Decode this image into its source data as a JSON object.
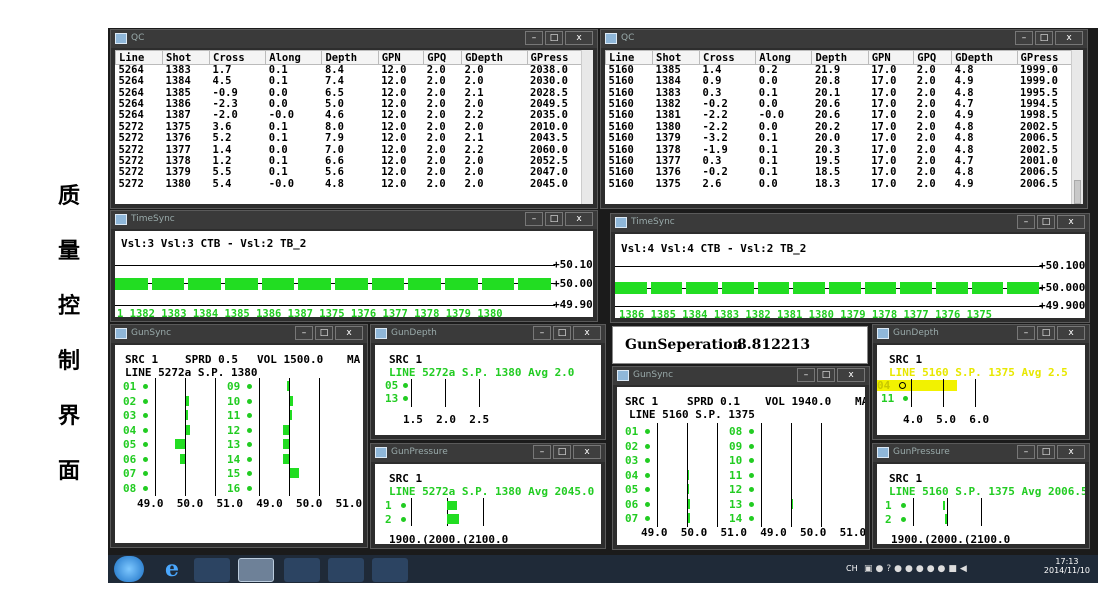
{
  "sidebar": {
    "chars": [
      "质",
      "量",
      "控",
      "制",
      "界",
      "面"
    ]
  },
  "qc_left": {
    "title": "QC",
    "columns": [
      "Line",
      "Shot",
      "Cross",
      "Along",
      "Depth",
      "GPN",
      "GPQ",
      "GDepth",
      "GPress"
    ],
    "rows": [
      [
        "5264",
        "1383",
        "1.7",
        "0.1",
        "8.4",
        "12.0",
        "2.0",
        "2.0",
        "2038.0"
      ],
      [
        "5264",
        "1384",
        "4.5",
        "0.1",
        "7.4",
        "12.0",
        "2.0",
        "2.0",
        "2030.0"
      ],
      [
        "5264",
        "1385",
        "-0.9",
        "0.0",
        "6.5",
        "12.0",
        "2.0",
        "2.1",
        "2028.5"
      ],
      [
        "5264",
        "1386",
        "-2.3",
        "0.0",
        "5.0",
        "12.0",
        "2.0",
        "2.0",
        "2049.5"
      ],
      [
        "5264",
        "1387",
        "-2.0",
        "-0.0",
        "4.6",
        "12.0",
        "2.0",
        "2.2",
        "2035.0"
      ],
      [
        "5272",
        "1375",
        "3.6",
        "0.1",
        "8.0",
        "12.0",
        "2.0",
        "2.0",
        "2010.0"
      ],
      [
        "5272",
        "1376",
        "5.2",
        "0.1",
        "7.9",
        "12.0",
        "2.0",
        "2.1",
        "2043.5"
      ],
      [
        "5272",
        "1377",
        "1.4",
        "0.0",
        "7.0",
        "12.0",
        "2.0",
        "2.2",
        "2060.0"
      ],
      [
        "5272",
        "1378",
        "1.2",
        "0.1",
        "6.6",
        "12.0",
        "2.0",
        "2.0",
        "2052.5"
      ],
      [
        "5272",
        "1379",
        "5.5",
        "0.1",
        "5.6",
        "12.0",
        "2.0",
        "2.0",
        "2047.0"
      ],
      [
        "5272",
        "1380",
        "5.4",
        "-0.0",
        "4.8",
        "12.0",
        "2.0",
        "2.0",
        "2045.0"
      ]
    ]
  },
  "qc_right": {
    "title": "QC",
    "columns": [
      "Line",
      "Shot",
      "Cross",
      "Along",
      "Depth",
      "GPN",
      "GPQ",
      "GDepth",
      "GPress"
    ],
    "rows": [
      [
        "5160",
        "1385",
        "1.4",
        "0.2",
        "21.9",
        "17.0",
        "2.0",
        "4.8",
        "1999.0"
      ],
      [
        "5160",
        "1384",
        "0.9",
        "0.0",
        "20.8",
        "17.0",
        "2.0",
        "4.9",
        "1999.0"
      ],
      [
        "5160",
        "1383",
        "0.3",
        "0.1",
        "20.1",
        "17.0",
        "2.0",
        "4.8",
        "1995.5"
      ],
      [
        "5160",
        "1382",
        "-0.2",
        "0.0",
        "20.6",
        "17.0",
        "2.0",
        "4.7",
        "1994.5"
      ],
      [
        "5160",
        "1381",
        "-2.2",
        "-0.0",
        "20.6",
        "17.0",
        "2.0",
        "4.9",
        "1998.5"
      ],
      [
        "5160",
        "1380",
        "-2.2",
        "0.0",
        "20.2",
        "17.0",
        "2.0",
        "4.8",
        "2002.5"
      ],
      [
        "5160",
        "1379",
        "-3.2",
        "0.1",
        "20.0",
        "17.0",
        "2.0",
        "4.8",
        "2006.5"
      ],
      [
        "5160",
        "1378",
        "-1.9",
        "0.1",
        "20.3",
        "17.0",
        "2.0",
        "4.8",
        "2002.5"
      ],
      [
        "5160",
        "1377",
        "0.3",
        "0.1",
        "19.5",
        "17.0",
        "2.0",
        "4.7",
        "2001.0"
      ],
      [
        "5160",
        "1376",
        "-0.2",
        "0.1",
        "18.5",
        "17.0",
        "2.0",
        "4.8",
        "2006.5"
      ],
      [
        "5160",
        "1375",
        "2.6",
        "0.0",
        "18.3",
        "17.0",
        "2.0",
        "4.9",
        "2006.5"
      ]
    ]
  },
  "timesync_left": {
    "title": "TimeSync",
    "header": "Vsl:3 Vsl:3 CTB - Vsl:2 TB_2",
    "scale": [
      "+50.100",
      "+50.000",
      "+49.900"
    ],
    "shots": [
      "1 1382",
      "1383",
      "1384",
      "1385",
      "1386",
      "1387",
      "1375",
      "1376",
      "1377",
      "1378",
      "1379",
      "1380"
    ]
  },
  "timesync_right": {
    "title": "TimeSync",
    "header": "Vsl:4 Vsl:4 CTB - Vsl:2 TB_2",
    "scale": [
      "+50.100",
      "+50.000",
      "+49.900"
    ],
    "shots": [
      "1386",
      "1385",
      "1384",
      "1383",
      "1382",
      "1381",
      "1380",
      "1379",
      "1378",
      "1377",
      "1376",
      "1375"
    ]
  },
  "gunsync_left": {
    "title": "GunSync",
    "src": "SRC 1",
    "sprd": "SPRD 0.5",
    "vol": "VOL 1500.0",
    "trunc": "MA",
    "line": "LINE 5272a S.P. 1380",
    "guns_left": [
      "01",
      "02",
      "03",
      "04",
      "05",
      "06",
      "07",
      "08"
    ],
    "guns_right": [
      "09",
      "10",
      "11",
      "12",
      "13",
      "14",
      "15",
      "16"
    ],
    "axis": "49.0  50.0  51.0  49.0  50.0  51.0"
  },
  "gundepth_left": {
    "title": "GunDepth",
    "src": "SRC 1",
    "line": "LINE 5272a S.P. 1380 Avg 2.0",
    "guns": [
      "05",
      "13"
    ],
    "axis": "1.5  2.0  2.5"
  },
  "gunpressure_left": {
    "title": "GunPressure",
    "src": "SRC 1",
    "line": "LINE 5272a S.P. 1380 Avg 2045.0",
    "guns": [
      "1",
      "2"
    ],
    "axis": "1900.(2000.(2100.0"
  },
  "gunseparation": {
    "label": "GunSeperation",
    "value": "8.812213"
  },
  "gunsync_right": {
    "title": "GunSync",
    "src": "SRC 1",
    "sprd": "SPRD 0.1",
    "vol": "VOL 1940.0",
    "trunc": "MA",
    "line": "LINE 5160 S.P. 1375",
    "guns_left": [
      "01",
      "02",
      "03",
      "04",
      "05",
      "06",
      "07"
    ],
    "guns_right": [
      "08",
      "09",
      "10",
      "11",
      "12",
      "13",
      "14"
    ],
    "axis": "49.0  50.0  51.0  49.0  50.0  51.0"
  },
  "gundepth_right": {
    "title": "GunDepth",
    "src": "SRC 1",
    "line": "LINE 5160 S.P. 1375 Avg 2.5",
    "guns": [
      "04",
      "11"
    ],
    "axis": "4.0  5.0  6.0"
  },
  "gunpressure_right": {
    "title": "GunPressure",
    "src": "SRC 1",
    "line": "LINE 5160 S.P. 1375 Avg 2006.5",
    "guns": [
      "1",
      "2"
    ],
    "axis": "1900.(2000.(2100.0"
  },
  "taskbar": {
    "time": "17:13",
    "date": "2014/11/10",
    "lang": "CH",
    "apps": [
      "start-orb",
      "ie-icon",
      "network-app-icon",
      "console-app-icon",
      "disc-app-icon",
      "display-app-icon",
      "tool-app-icon"
    ]
  },
  "colors": {
    "bar_green": "#22dd22",
    "text_green": "#22cc22",
    "highlight_yellow": "#e8e800",
    "taskbar": "#1f2a38"
  }
}
